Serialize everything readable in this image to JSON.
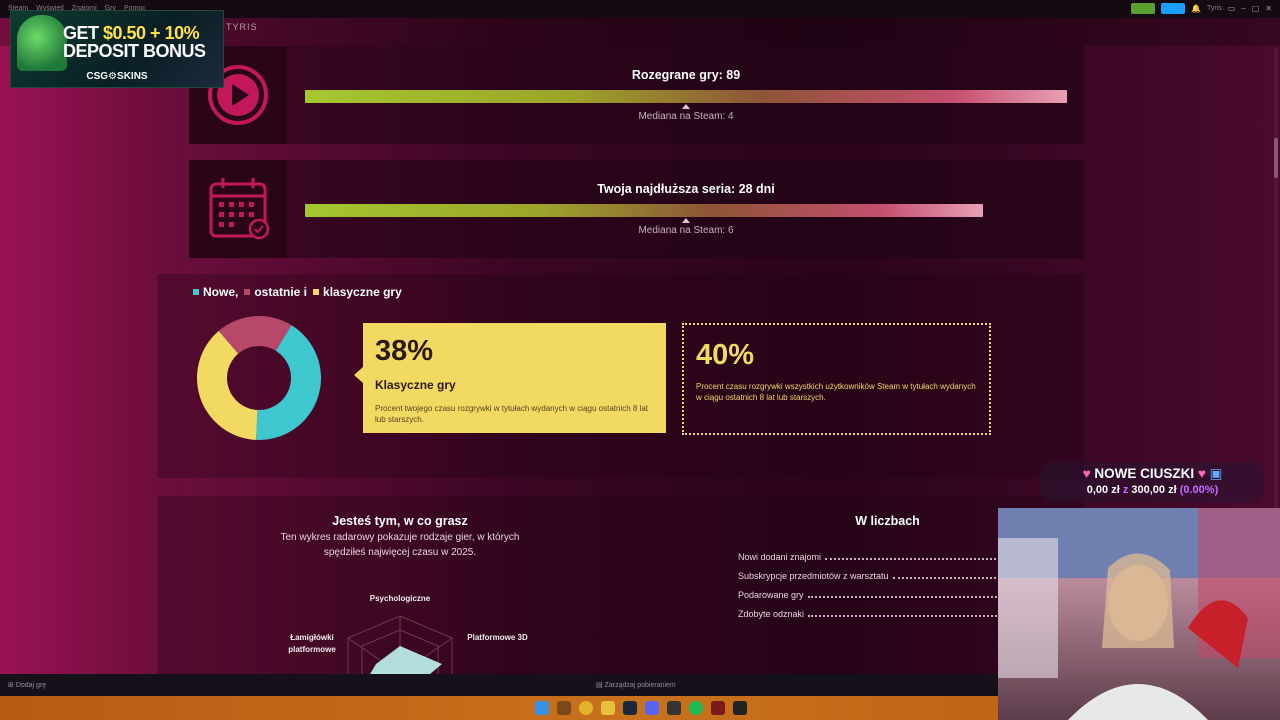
{
  "titlebar": {
    "menu": [
      "Steam",
      "Wyświetl",
      "Znajomi",
      "Gry",
      "Pomoc"
    ],
    "user": "Tyris"
  },
  "nav": {
    "label": "TYRIS"
  },
  "stats": [
    {
      "title": "Rozegrane gry: 89",
      "median": "Mediana na Steam: 4",
      "icon": "play-icon",
      "fill": 1.0
    },
    {
      "title": "Twoja najdłuższa seria: 28 dni",
      "median": "Mediana na Steam: 6",
      "icon": "calendar-icon",
      "fill": 0.89
    }
  ],
  "legend": {
    "new_label": "Nowe,",
    "recent_label": "ostatnie i",
    "classic_label": "klasyczne gry",
    "colors": {
      "new": "#3fc7cf",
      "recent": "#b8486a",
      "classic": "#f1d962"
    }
  },
  "donut": {
    "segments": [
      {
        "name": "new",
        "value": 42,
        "color": "#3fc7cf"
      },
      {
        "name": "classic",
        "value": 38,
        "color": "#f1d962"
      },
      {
        "name": "recent",
        "value": 20,
        "color": "#b8486a"
      }
    ]
  },
  "callout": {
    "percent": "38%",
    "title": "Klasyczne gry",
    "description": "Procent twojego czasu rozgrywki w tytułach wydanych w ciągu ostatnich 8 lat lub starszych."
  },
  "global": {
    "percent": "40%",
    "description": "Procent czasu rozgrywki wszystkich użytkowników Steam w tytułach wydanych w ciągu ostatnich 8 lat lub starszych."
  },
  "radar": {
    "title": "Jesteś tym, w co grasz",
    "subtitle": "Ten wykres radarowy pokazuje rodzaje gier, w których spędziłeś najwięcej czasu w 2025.",
    "axes": [
      "Psychologiczne",
      "Platformowe 3D",
      "Łamigłówki platformowe"
    ]
  },
  "numbers": {
    "title": "W liczbach",
    "rows": [
      "Nowi dodani znajomi",
      "Subskrypcje przedmiotów z warsztatu",
      "Podarowane gry",
      "Zdobyte odznaki"
    ]
  },
  "bottombar": {
    "add_game": "Dodaj grę",
    "downloads": "Zarządzaj pobieraniem"
  },
  "ad": {
    "line1_a": "GET ",
    "line1_b": "$0.50 + 10%",
    "line2": "DEPOSIT BONUS",
    "brand": "CSG⚙SKINS"
  },
  "goal": {
    "title": "NOWE CIUSZKI",
    "current": "0,00 zł",
    "sep": "z",
    "target": "300,00 zł",
    "pct": "(0.00%)"
  }
}
